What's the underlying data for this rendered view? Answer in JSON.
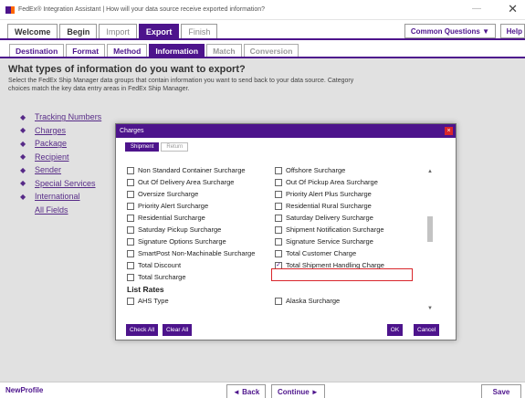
{
  "window": {
    "title": "FedEx® Integration Assistant | How will your data source receive exported information?",
    "minimize": "—",
    "close": "✕"
  },
  "topnav": {
    "tabs": [
      {
        "label": "Welcome"
      },
      {
        "label": "Begin"
      },
      {
        "label": "Import"
      },
      {
        "label": "Export"
      },
      {
        "label": "Finish"
      }
    ],
    "common_questions": "Common Questions ▼",
    "help": "Help"
  },
  "subnav": {
    "tabs": [
      {
        "label": "Destination"
      },
      {
        "label": "Format"
      },
      {
        "label": "Method"
      },
      {
        "label": "Information"
      },
      {
        "label": "Match"
      },
      {
        "label": "Conversion"
      }
    ]
  },
  "main": {
    "heading": "What types of information do you want to export?",
    "description": "Select the FedEx Ship Manager data groups that contain information you want to send back to your data source. Category choices match the key data entry areas in FedEx Ship Manager.",
    "categories": [
      {
        "label": "Tracking Numbers"
      },
      {
        "label": "Charges"
      },
      {
        "label": "Package"
      },
      {
        "label": "Recipient"
      },
      {
        "label": "Sender"
      },
      {
        "label": "Special Services"
      },
      {
        "label": "International"
      },
      {
        "label": "All Fields"
      }
    ]
  },
  "modal": {
    "title": "Charges",
    "close_icon": "×",
    "tabs": [
      {
        "label": "Shipment"
      },
      {
        "label": "Return"
      }
    ],
    "left_options": [
      {
        "label": "Non Standard Container Surcharge",
        "checked": false
      },
      {
        "label": "Out Of Delivery Area Surcharge",
        "checked": false
      },
      {
        "label": "Oversize Surcharge",
        "checked": false
      },
      {
        "label": "Priority Alert Surcharge",
        "checked": false
      },
      {
        "label": "Residential Surcharge",
        "checked": false
      },
      {
        "label": "Saturday Pickup Surcharge",
        "checked": false
      },
      {
        "label": "Signature Options Surcharge",
        "checked": false
      },
      {
        "label": "SmartPost Non-Machinable Surcharge",
        "checked": false
      },
      {
        "label": "Total Discount",
        "checked": false
      },
      {
        "label": "Total Surcharge",
        "checked": false
      }
    ],
    "right_options": [
      {
        "label": "Offshore Surcharge",
        "checked": false
      },
      {
        "label": "Out Of Pickup Area Surcharge",
        "checked": false
      },
      {
        "label": "Priority Alert Plus Surcharge",
        "checked": false
      },
      {
        "label": "Residential Rural Surcharge",
        "checked": false
      },
      {
        "label": "Saturday Delivery Surcharge",
        "checked": false
      },
      {
        "label": "Shipment Notification Surcharge",
        "checked": false
      },
      {
        "label": "Signature Service Surcharge",
        "checked": false
      },
      {
        "label": "Total Customer Charge",
        "checked": false
      },
      {
        "label": "Total Shipment Handling Charge",
        "checked": true
      }
    ],
    "list_rates": {
      "heading": "List Rates",
      "left": [
        {
          "label": "AHS Type",
          "checked": false
        }
      ],
      "right": [
        {
          "label": "Alaska Surcharge",
          "checked": false
        }
      ]
    },
    "buttons": {
      "check_all": "Check All",
      "clear_all": "Clear All",
      "ok": "OK",
      "cancel": "Cancel"
    }
  },
  "bottom": {
    "profile": "NewProfile",
    "back": "◄ Back",
    "continue": "Continue ►",
    "save": "Save"
  },
  "colors": {
    "brand_purple": "#4d148c",
    "fedex_orange": "#ff6600",
    "highlight_red": "#d9262b"
  }
}
